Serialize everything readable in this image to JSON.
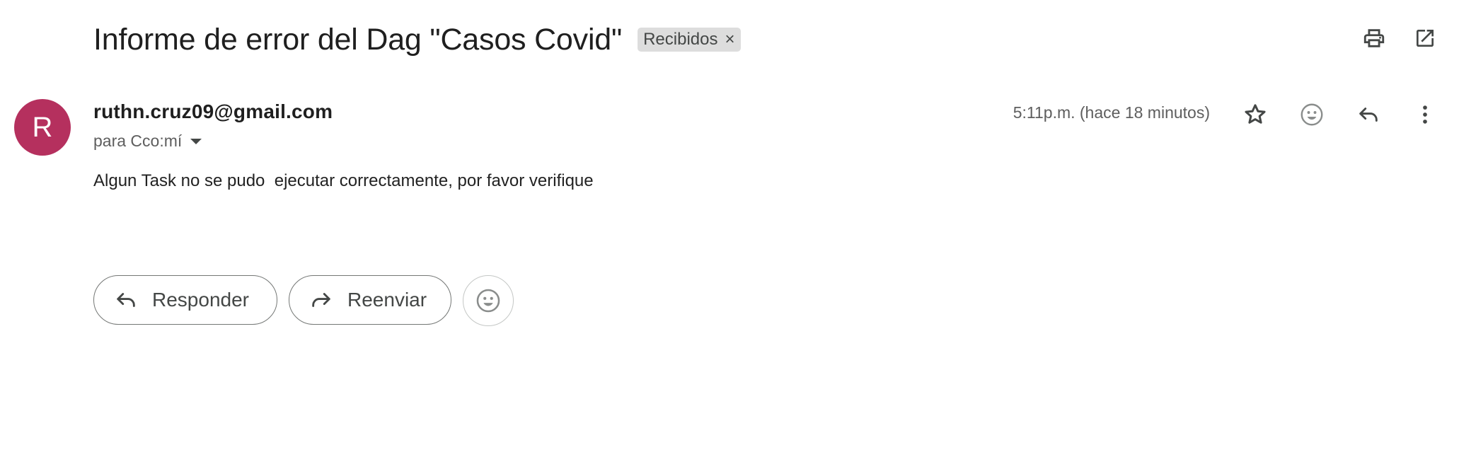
{
  "email": {
    "subject": "Informe de error del Dag \"Casos Covid\"",
    "label_chip": {
      "text": "Recibidos",
      "remove_symbol": "×"
    },
    "top_actions": [
      "print-icon",
      "open-in-new-window-icon"
    ],
    "sender": {
      "avatar_letter": "R",
      "avatar_color": "#b5305e",
      "address": "ruthn.cruz09@gmail.com",
      "recipients": "para Cco:mí"
    },
    "time": "5:11p.m. (hace 18 minutos)",
    "header_actions": [
      "star-icon",
      "emoji-reaction-icon",
      "reply-icon",
      "more-options-icon"
    ],
    "body": "Algun Task no se pudo  ejecutar correctamente, por favor verifique",
    "reply_buttons": {
      "reply_label": "Responder",
      "forward_label": "Reenviar"
    }
  }
}
